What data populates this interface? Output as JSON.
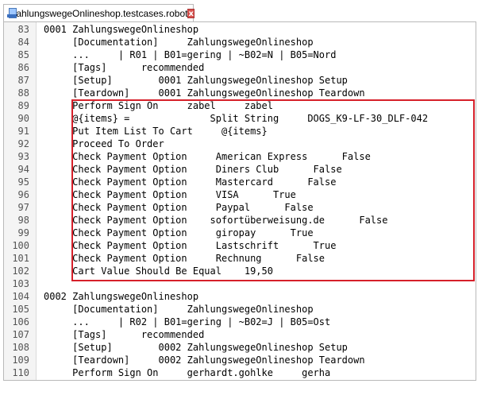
{
  "tab": {
    "title": "ZahlungswegeOnlineshop.testcases.robot",
    "close_glyph": "x",
    "icon": "robot-file-icon"
  },
  "editor": {
    "highlight_color": "#d6202a",
    "lines": [
      {
        "num": "83",
        "text": "0001 ZahlungswegeOnlineshop"
      },
      {
        "num": "84",
        "text": "     [Documentation]     ZahlungswegeOnlineshop"
      },
      {
        "num": "85",
        "text": "     ...     | R01 | B01=gering | ~B02=N | B05=Nord"
      },
      {
        "num": "86",
        "text": "     [Tags]      recommended"
      },
      {
        "num": "87",
        "text": "     [Setup]        0001 ZahlungswegeOnlineshop Setup"
      },
      {
        "num": "88",
        "text": "     [Teardown]     0001 ZahlungswegeOnlineshop Teardown"
      },
      {
        "num": "89",
        "text": "     Perform Sign On     zabel     zabel"
      },
      {
        "num": "90",
        "text": "     @{items} =              Split String     DOGS_K9-LF-30_DLF-042"
      },
      {
        "num": "91",
        "text": "     Put Item List To Cart     @{items}"
      },
      {
        "num": "92",
        "text": "     Proceed To Order"
      },
      {
        "num": "93",
        "text": "     Check Payment Option     American Express      False"
      },
      {
        "num": "94",
        "text": "     Check Payment Option     Diners Club      False"
      },
      {
        "num": "95",
        "text": "     Check Payment Option     Mastercard      False"
      },
      {
        "num": "96",
        "text": "     Check Payment Option     VISA      True"
      },
      {
        "num": "97",
        "text": "     Check Payment Option     Paypal      False"
      },
      {
        "num": "98",
        "text": "     Check Payment Option    sofortüberweisung.de      False"
      },
      {
        "num": "99",
        "text": "     Check Payment Option     giropay      True"
      },
      {
        "num": "100",
        "text": "     Check Payment Option     Lastschrift      True"
      },
      {
        "num": "101",
        "text": "     Check Payment Option     Rechnung      False"
      },
      {
        "num": "102",
        "text": "     Cart Value Should Be Equal    19,50"
      },
      {
        "num": "103",
        "text": ""
      },
      {
        "num": "104",
        "text": "0002 ZahlungswegeOnlineshop"
      },
      {
        "num": "105",
        "text": "     [Documentation]     ZahlungswegeOnlineshop"
      },
      {
        "num": "106",
        "text": "     ...     | R02 | B01=gering | ~B02=J | B05=Ost"
      },
      {
        "num": "107",
        "text": "     [Tags]      recommended"
      },
      {
        "num": "108",
        "text": "     [Setup]        0002 ZahlungswegeOnlineshop Setup"
      },
      {
        "num": "109",
        "text": "     [Teardown]     0002 ZahlungswegeOnlineshop Teardown"
      },
      {
        "num": "110",
        "text": "     Perform Sign On     gerhardt.gohlke     gerha"
      }
    ]
  }
}
